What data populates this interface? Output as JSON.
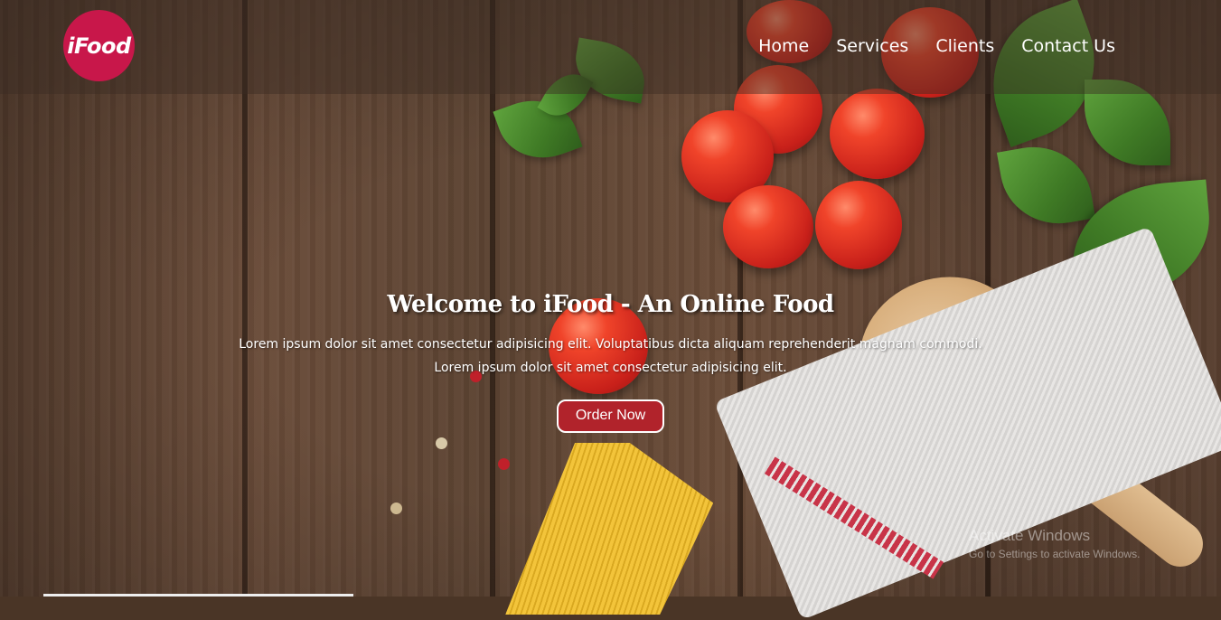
{
  "brand": {
    "logo_text": "iFood",
    "logo_color": "#c8174a"
  },
  "nav": {
    "items": [
      {
        "label": "Home"
      },
      {
        "label": "Services"
      },
      {
        "label": "Clients"
      },
      {
        "label": "Contact Us"
      }
    ]
  },
  "hero": {
    "title": "Welcome to iFood - An Online Food",
    "line1": "Lorem ipsum dolor sit amet consectetur adipisicing elit. Voluptatibus dicta aliquam reprehenderit magnam commodi.",
    "line2": "Lorem ipsum dolor sit amet consectetur adipisicing elit.",
    "cta_label": "Order Now",
    "cta_color": "#b1232b"
  },
  "system": {
    "watermark_title": "Activate Windows",
    "watermark_sub": "Go to Settings to activate Windows."
  }
}
